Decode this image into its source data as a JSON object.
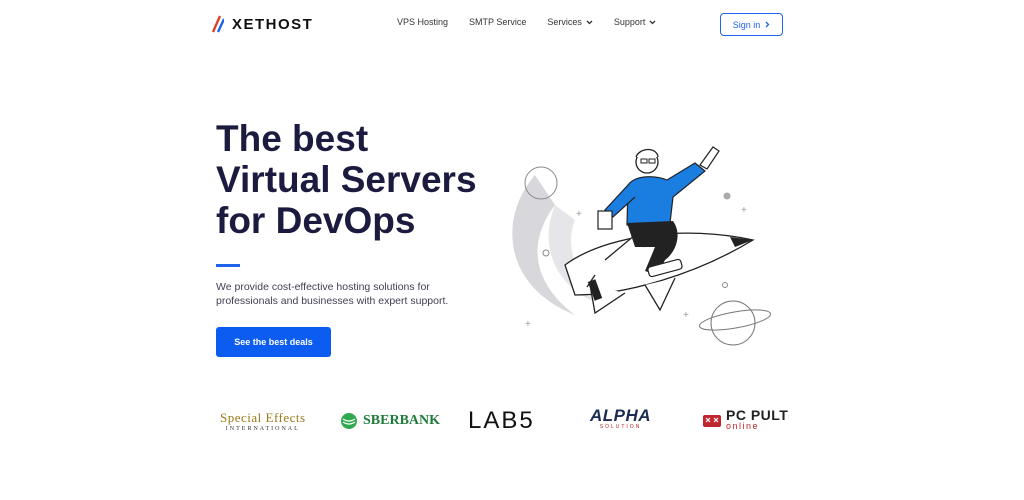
{
  "header": {
    "logo_text": "XETHOST",
    "nav": [
      {
        "label": "VPS Hosting",
        "dropdown": false
      },
      {
        "label": "SMTP Service",
        "dropdown": false
      },
      {
        "label": "Services",
        "dropdown": true
      },
      {
        "label": "Support",
        "dropdown": true
      }
    ],
    "signin_label": "Sign in"
  },
  "hero": {
    "title_line1": "The best",
    "title_line2": "Virtual Servers",
    "title_line3": "for DevOps",
    "description": "We provide cost-effective hosting solutions for professionals and businesses with expert support.",
    "cta_label": "See the best deals"
  },
  "partners": {
    "special_effects": {
      "line1": "Special Effects",
      "line2": "INTERNATIONAL"
    },
    "sberbank": "SBERBANK",
    "lab5": "LAB5",
    "alpha": {
      "name": "ALPHA",
      "sub": "SOLUTION"
    },
    "pcpult": {
      "name": "PC PULT",
      "sub": "online"
    }
  },
  "colors": {
    "accent": "#1e63e9",
    "cta": "#0c5cf2",
    "title": "#1b1b3f"
  }
}
